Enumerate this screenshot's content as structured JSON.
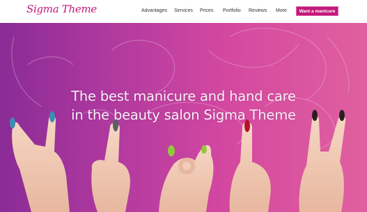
{
  "brand": {
    "logo_text": "Sigma Theme",
    "accent_color": "#c2197a"
  },
  "nav": {
    "items": [
      {
        "label": "Advantages"
      },
      {
        "label": "Services"
      },
      {
        "label": "Prices"
      },
      {
        "label": "Portfolio"
      },
      {
        "label": "Reviews"
      },
      {
        "label": "More"
      }
    ],
    "cta_label": "Want a manicure"
  },
  "hero": {
    "headline_line1": "The best manicure and hand care",
    "headline_line2": "in the beauty salon Sigma Theme",
    "background_colors": [
      "#8a2b96",
      "#e0609f"
    ],
    "image": "hands-with-painted-nails"
  }
}
